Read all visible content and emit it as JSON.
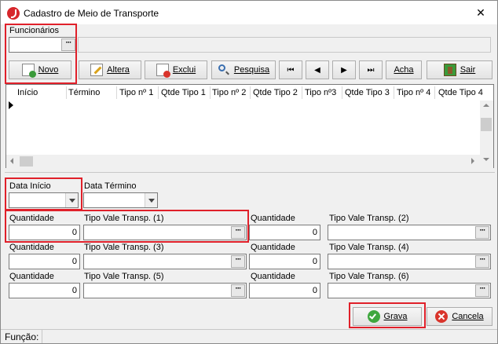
{
  "window": {
    "title": "Cadastro de Meio de Transporte"
  },
  "funcionarios": {
    "label": "Funcionários",
    "code_value": "",
    "name_value": ""
  },
  "toolbar": {
    "novo": "Novo",
    "altera": "Altera",
    "exclui": "Exclui",
    "pesquisa": "Pesquisa",
    "first": "⏮",
    "prev": "◀",
    "next": "▶",
    "last": "⏭",
    "acha": "Acha",
    "sair": "Sair"
  },
  "grid": {
    "columns": [
      "Início",
      "Término",
      "Tipo nº 1",
      "Qtde Tipo 1",
      "Tipo nº 2",
      "Qtde Tipo 2",
      "Tipo nº3",
      "Qtde Tipo 3",
      "Tipo nº 4",
      "Qtde Tipo 4"
    ],
    "rows": []
  },
  "form": {
    "data_inicio_label": "Data Início",
    "data_termino_label": "Data Término",
    "data_inicio_value": "",
    "data_termino_value": "",
    "qty_label": "Quantidade",
    "vt1_label": "Tipo Vale Transp. (1)",
    "vt2_label": "Tipo Vale Transp. (2)",
    "vt3_label": "Tipo Vale Transp. (3)",
    "vt4_label": "Tipo Vale Transp. (4)",
    "vt5_label": "Tipo Vale Transp. (5)",
    "vt6_label": "Tipo Vale Transp. (6)",
    "qty1_value": "0",
    "qty2_value": "0",
    "qty3_value": "0",
    "qty4_value": "0",
    "qty5_value": "0",
    "qty6_value": "0",
    "vt_value": ""
  },
  "actions": {
    "grava": "Grava",
    "cancela": "Cancela"
  },
  "status": {
    "funcao_label": "Função:"
  }
}
